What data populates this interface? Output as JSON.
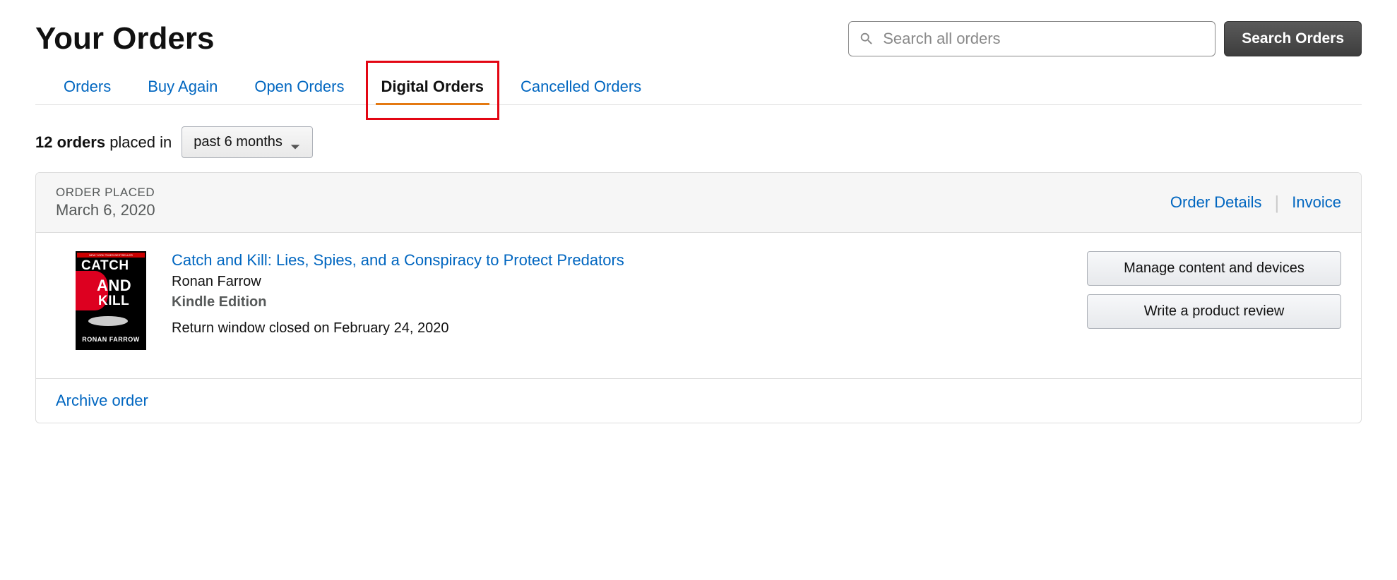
{
  "page": {
    "title": "Your Orders"
  },
  "search": {
    "placeholder": "Search all orders",
    "button_label": "Search Orders"
  },
  "tabs": {
    "orders": "Orders",
    "buy_again": "Buy Again",
    "open_orders": "Open Orders",
    "digital_orders": "Digital Orders",
    "cancelled_orders": "Cancelled Orders"
  },
  "filter": {
    "count": "12 orders",
    "placed_in": "placed in",
    "range": "past 6 months"
  },
  "order": {
    "placed_label": "ORDER PLACED",
    "date": "March 6, 2020",
    "details_link": "Order Details",
    "invoice_link": "Invoice",
    "item": {
      "title": "Catch and Kill: Lies, Spies, and a Conspiracy to Protect Predators",
      "author": "Ronan Farrow",
      "edition": "Kindle Edition",
      "return_info": "Return window closed on February 24, 2020",
      "cover_title_1": "CATCH",
      "cover_title_2": "AND",
      "cover_title_3": "KILL",
      "cover_author": "RONAN FARROW"
    },
    "actions": {
      "manage": "Manage content and devices",
      "review": "Write a product review"
    },
    "archive": "Archive order"
  }
}
